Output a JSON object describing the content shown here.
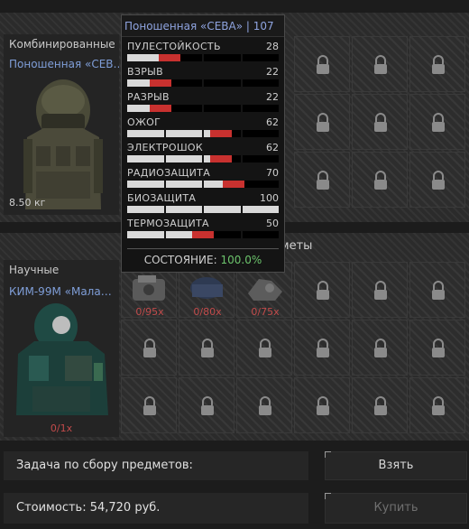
{
  "armor_slot": {
    "category": "Комбинированные",
    "item_name": "Поношенная «СЕВ…",
    "weight": "8.50 кг"
  },
  "suit_slot": {
    "category": "Научные",
    "item_name": "КИМ-99М «Мала…",
    "count": "0/1x"
  },
  "consumables": {
    "header": "Необходимые предметы",
    "items": [
      {
        "count": "0/95x"
      },
      {
        "count": "0/80x"
      },
      {
        "count": "0/75x"
      }
    ]
  },
  "tooltip": {
    "title": "Поношенная «СЕВА» | 107",
    "stats": [
      {
        "name": "ПУЛЕСТОЙКОСТЬ",
        "value": "28",
        "fill": 0.28
      },
      {
        "name": "ВЗРЫВ",
        "value": "22",
        "fill": 0.22
      },
      {
        "name": "РАЗРЫВ",
        "value": "22",
        "fill": 0.22
      },
      {
        "name": "ОЖОГ",
        "value": "62",
        "fill": 0.62
      },
      {
        "name": "ЭЛЕКТРОШОК",
        "value": "62",
        "fill": 0.62
      },
      {
        "name": "РАДИОЗАЩИТА",
        "value": "70",
        "fill": 0.7
      },
      {
        "name": "БИОЗАЩИТА",
        "value": "100",
        "fill": 1.0
      },
      {
        "name": "ТЕРМОЗАЩИТА",
        "value": "50",
        "fill": 0.5
      }
    ],
    "state_label": "СОСТОЯНИЕ:",
    "state_value": "100.0%"
  },
  "footer": {
    "task_label": "Задача по сбору предметов:",
    "cost_label": "Стоимость: 54,720 руб.",
    "take_button": "Взять",
    "buy_button": "Купить"
  },
  "colors": {
    "accent_blue": "#7f9ed8",
    "bar_red": "#c8312f",
    "count_red": "#c24b4b",
    "state_green": "#6cc46c"
  }
}
